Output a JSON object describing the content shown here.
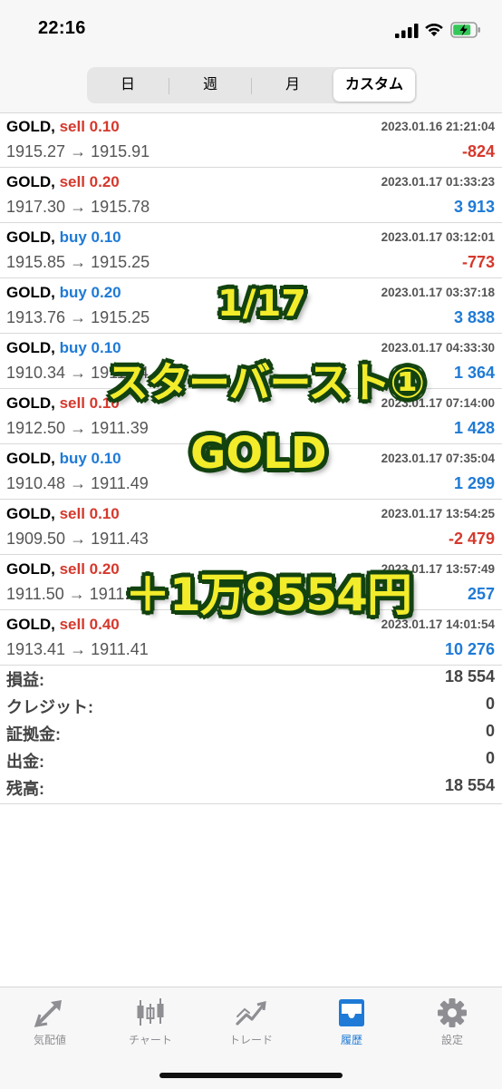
{
  "status_bar": {
    "time": "22:16"
  },
  "period_tabs": [
    {
      "label": "日",
      "active": false
    },
    {
      "label": "週",
      "active": false
    },
    {
      "label": "月",
      "active": false
    },
    {
      "label": "カスタム",
      "active": true
    }
  ],
  "trades": [
    {
      "symbol": "GOLD,",
      "side": "sell 0.10",
      "side_type": "sell",
      "datetime": "2023.01.16 21:21:04",
      "prices": "1915.27 → 1915.91",
      "profit": "-824",
      "profit_type": "neg"
    },
    {
      "symbol": "GOLD,",
      "side": "sell 0.20",
      "side_type": "sell",
      "datetime": "2023.01.17 01:33:23",
      "prices": "1917.30 → 1915.78",
      "profit": "3 913",
      "profit_type": "pos"
    },
    {
      "symbol": "GOLD,",
      "side": "buy 0.10",
      "side_type": "buy",
      "datetime": "2023.01.17 03:12:01",
      "prices": "1915.85 → 1915.25",
      "profit": "-773",
      "profit_type": "neg"
    },
    {
      "symbol": "GOLD,",
      "side": "buy 0.20",
      "side_type": "buy",
      "datetime": "2023.01.17 03:37:18",
      "prices": "1913.76 → 1915.25",
      "profit": "3 838",
      "profit_type": "pos"
    },
    {
      "symbol": "GOLD,",
      "side": "buy 0.10",
      "side_type": "buy",
      "datetime": "2023.01.17 04:33:30",
      "prices": "1910.34 → 1911.14",
      "profit": "1 364",
      "profit_type": "pos"
    },
    {
      "symbol": "GOLD,",
      "side": "sell 0.10",
      "side_type": "sell",
      "datetime": "2023.01.17 07:14:00",
      "prices": "1912.50 → 1911.39",
      "profit": "1 428",
      "profit_type": "pos"
    },
    {
      "symbol": "GOLD,",
      "side": "buy 0.10",
      "side_type": "buy",
      "datetime": "2023.01.17 07:35:04",
      "prices": "1910.48 → 1911.49",
      "profit": "1 299",
      "profit_type": "pos"
    },
    {
      "symbol": "GOLD,",
      "side": "sell 0.10",
      "side_type": "sell",
      "datetime": "2023.01.17 13:54:25",
      "prices": "1909.50 → 1911.43",
      "profit": "-2 479",
      "profit_type": "neg"
    },
    {
      "symbol": "GOLD,",
      "side": "sell 0.20",
      "side_type": "sell",
      "datetime": "2023.01.17 13:57:49",
      "prices": "1911.50 → 1911.40",
      "profit": "257",
      "profit_type": "pos"
    },
    {
      "symbol": "GOLD,",
      "side": "sell 0.40",
      "side_type": "sell",
      "datetime": "2023.01.17 14:01:54",
      "prices": "1913.41 → 1911.41",
      "profit": "10 276",
      "profit_type": "pos"
    }
  ],
  "summary": [
    {
      "label": "損益:",
      "value": "18 554"
    },
    {
      "label": "クレジット:",
      "value": "0"
    },
    {
      "label": "証拠金:",
      "value": "0"
    },
    {
      "label": "出金:",
      "value": "0"
    },
    {
      "label": "残高:",
      "value": "18 554"
    }
  ],
  "overlay": {
    "date": "1/17",
    "strategy": "スターバースト①",
    "symbol": "GOLD",
    "result": "＋1万8554円"
  },
  "tab_bar": [
    {
      "label": "気配値",
      "icon": "quotes-arrows-icon",
      "active": false
    },
    {
      "label": "チャート",
      "icon": "candlestick-chart-icon",
      "active": false
    },
    {
      "label": "トレード",
      "icon": "trade-line-icon",
      "active": false
    },
    {
      "label": "履歴",
      "icon": "history-inbox-icon",
      "active": true
    },
    {
      "label": "設定",
      "icon": "gear-icon",
      "active": false
    }
  ],
  "colors": {
    "sell": "#d6382c",
    "buy": "#1e7ad6",
    "profit_negative": "#d6382c",
    "profit_positive": "#1e7ad6",
    "tab_active": "#1e7ad6",
    "overlay_text": "#f2ec2a",
    "overlay_outline": "#154412"
  }
}
